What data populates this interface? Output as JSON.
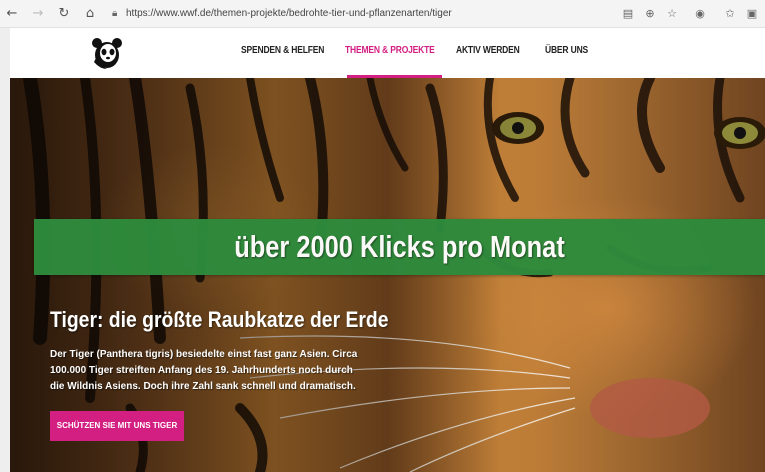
{
  "browser": {
    "url": "https://www.wwf.de/themen-projekte/bedrohte-tier-und-pflanzenarten/tiger",
    "icons": [
      "back-icon",
      "forward-icon",
      "reload-icon",
      "home-icon",
      "lock-icon",
      "reader-view-icon",
      "zoom-icon",
      "favorite-star-icon",
      "extension-icon",
      "favorites-icon",
      "collections-icon"
    ]
  },
  "nav": {
    "items": [
      {
        "label": "SPENDEN & HELFEN"
      },
      {
        "label": "THEMEN & PROJEKTE",
        "active": true
      },
      {
        "label": "AKTIV WERDEN"
      },
      {
        "label": "ÜBER UNS"
      }
    ]
  },
  "banner": {
    "text": "über 2000 Klicks pro Monat"
  },
  "hero": {
    "title": "Tiger: die größte Raubkatze der Erde",
    "body_lines": [
      "Der Tiger (Panthera tigris) besiedelte einst fast ganz Asien. Circa",
      "100.000 Tiger streiften Anfang des 19. Jahrhunderts noch durch",
      "die Wildnis Asiens. Doch ihre Zahl sank schnell und dramatisch."
    ],
    "cta_label": "SCHÜTZEN SIE MIT UNS TIGER"
  },
  "colors": {
    "accent": "#d41f82",
    "banner": "#2e8b3c"
  }
}
